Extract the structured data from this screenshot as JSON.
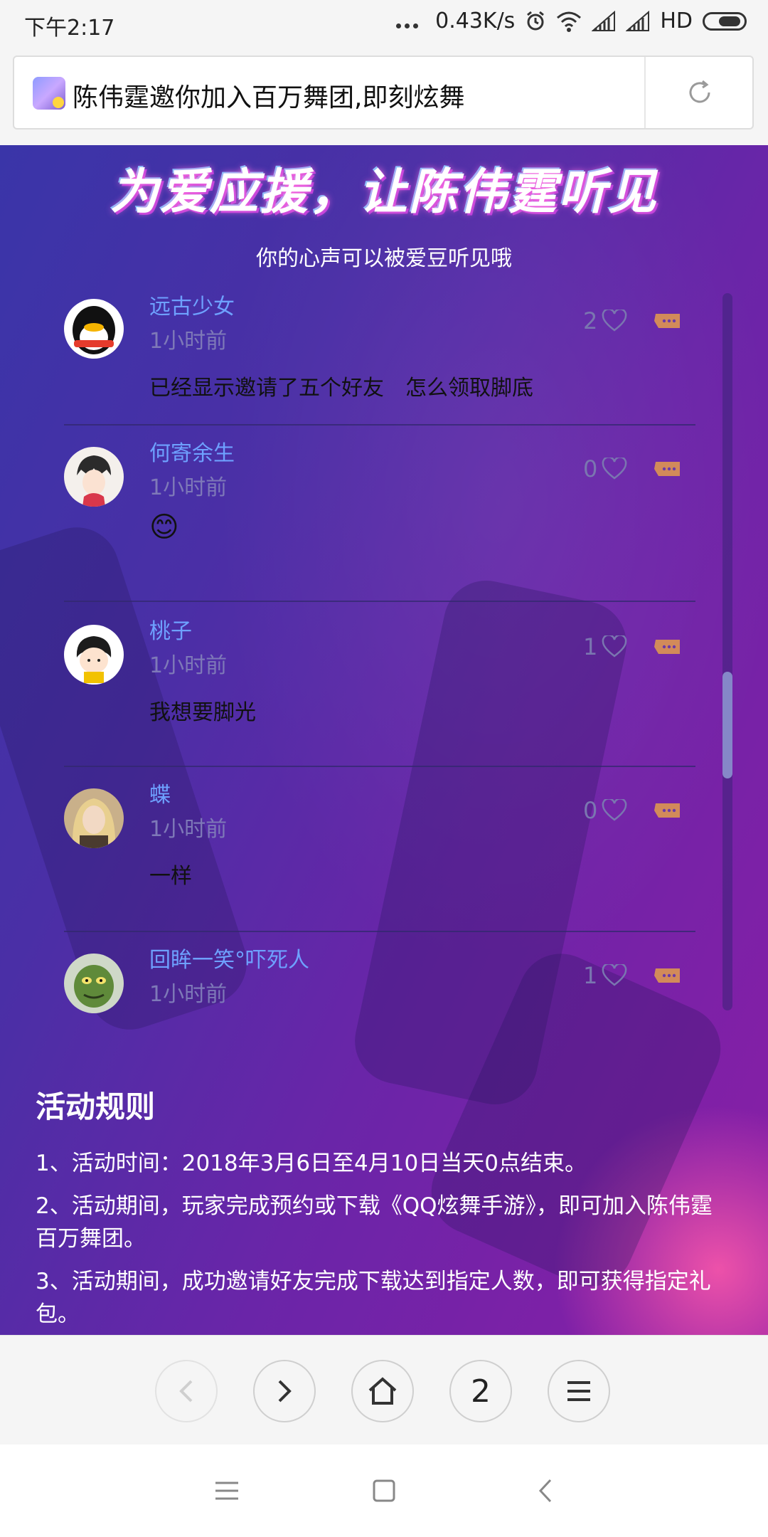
{
  "status_bar": {
    "time": "下午2:17",
    "network_speed": "0.43K/s",
    "signal_label": "HD",
    "icons": [
      "more-dots-icon",
      "alarm-icon",
      "wifi-icon",
      "signal-icon",
      "signal-icon",
      "battery-icon"
    ]
  },
  "url_bar": {
    "title": "陈伟霆邀你加入百万舞团,即刻炫舞",
    "reload_icon": "reload-icon"
  },
  "page": {
    "banner_title": "为爱应援，让陈伟霆听见",
    "banner_subtitle": "你的心声可以被爱豆听见哦",
    "comments": [
      {
        "name": "远古少女",
        "time": "1小时前",
        "text": "已经显示邀请了五个好友　怎么领取脚底",
        "likes": "2"
      },
      {
        "name": "何寄余生",
        "time": "1小时前",
        "text": "😊",
        "likes": "0"
      },
      {
        "name": "桃子",
        "time": "1小时前",
        "text": "我想要脚光",
        "likes": "1"
      },
      {
        "name": "蝶",
        "time": "1小时前",
        "text": "一样",
        "likes": "0"
      },
      {
        "name": "回眸一笑°吓死人",
        "time": "1小时前",
        "text": "",
        "likes": "1"
      }
    ],
    "rules_title": "活动规则",
    "rules": [
      "1、活动时间：2018年3月6日至4月10日当天0点结束。",
      "2、活动期间，玩家完成预约或下载《QQ炫舞手游》，即可加入陈伟霆百万舞团。",
      "3、活动期间，成功邀请好友完成下载达到指定人数，即可获得指定礼包。"
    ],
    "scroll_fraction": 0.55
  },
  "toolbar": {
    "tab_count": "2",
    "buttons": [
      "back-icon",
      "forward-icon",
      "home-icon",
      "tabs-button",
      "menu-icon"
    ]
  },
  "colors": {
    "name": "#6ea1ff",
    "time": "#7e79b8",
    "like": "#7a76b0",
    "reply": "#d28a5a",
    "bg_start": "#3a35a8",
    "bg_end": "#8a1ea6"
  }
}
